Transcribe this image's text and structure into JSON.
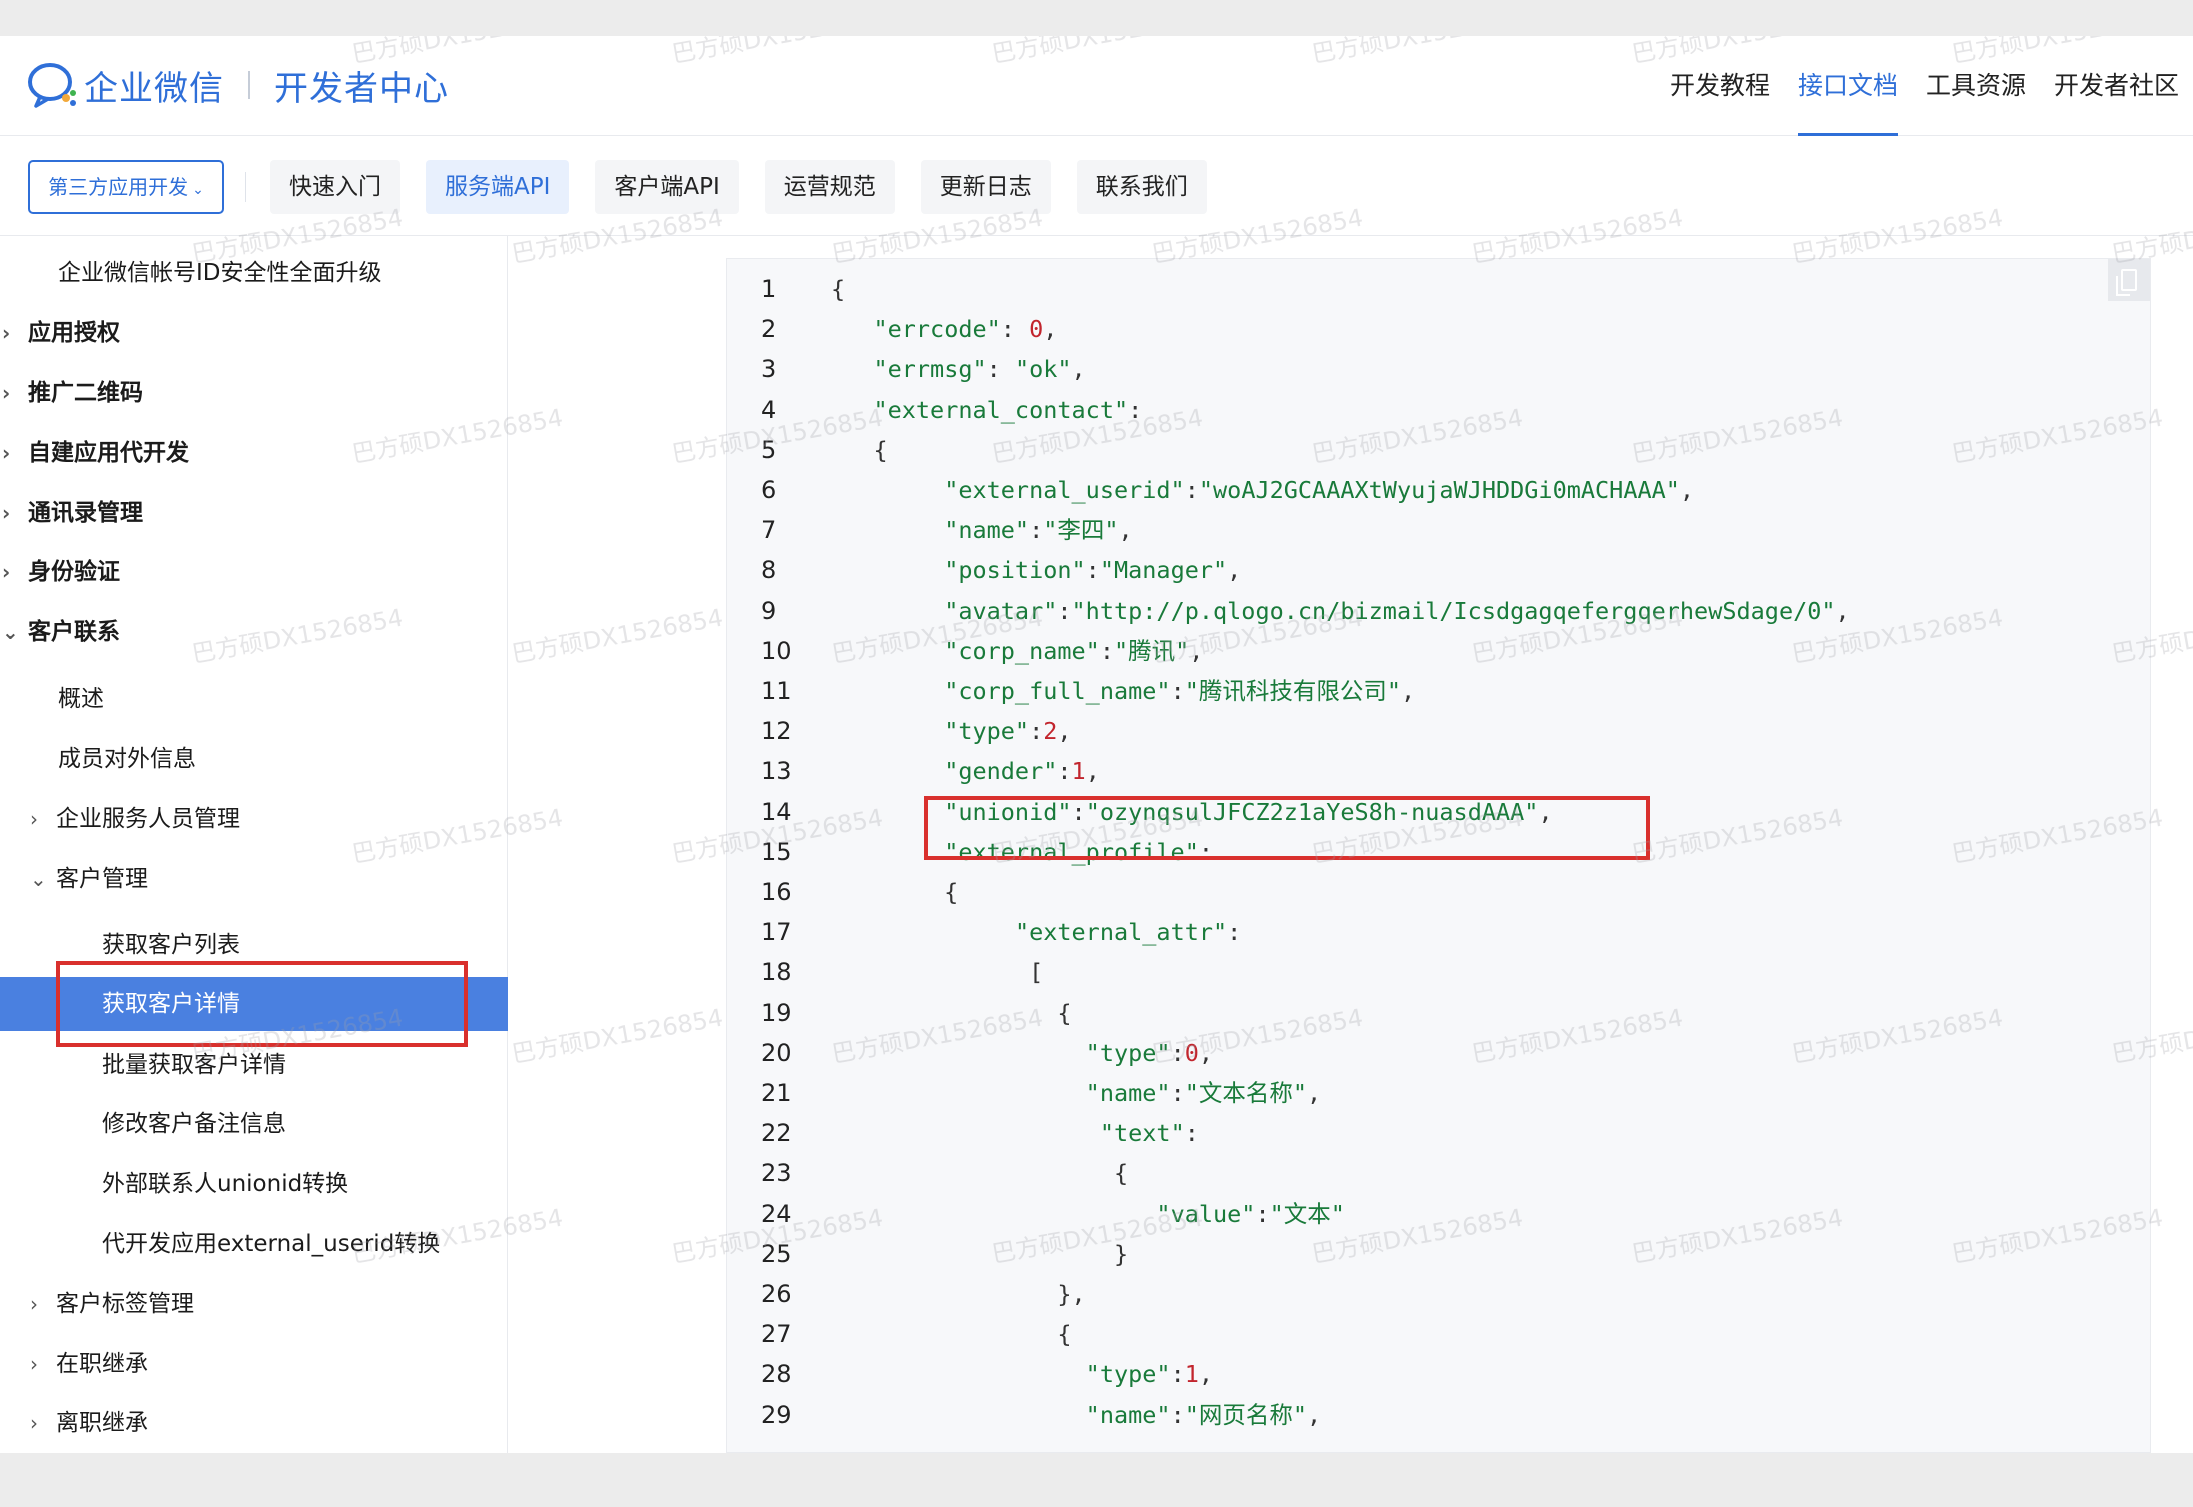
{
  "header": {
    "logo_text": "企业微信",
    "logo_sub": "开发者中心",
    "nav": [
      {
        "label": "开发教程",
        "active": false
      },
      {
        "label": "接口文档",
        "active": true
      },
      {
        "label": "工具资源",
        "active": false
      },
      {
        "label": "开发者社区",
        "active": false
      }
    ]
  },
  "subnav": {
    "dropdown_label": "第三方应用开发",
    "tabs": [
      {
        "label": "快速入门",
        "active": false
      },
      {
        "label": "服务端API",
        "active": true
      },
      {
        "label": "客户端API",
        "active": false
      },
      {
        "label": "运营规范",
        "active": false
      },
      {
        "label": "更新日志",
        "active": false
      },
      {
        "label": "联系我们",
        "active": false
      }
    ]
  },
  "sidebar": {
    "items": [
      {
        "label": "企业微信帐号ID安全性全面升级",
        "arrow": "",
        "bold": false
      },
      {
        "label": "应用授权",
        "arrow": ">",
        "bold": true
      },
      {
        "label": "推广二维码",
        "arrow": ">",
        "bold": true
      },
      {
        "label": "自建应用代开发",
        "arrow": ">",
        "bold": true
      },
      {
        "label": "通讯录管理",
        "arrow": ">",
        "bold": true
      },
      {
        "label": "身份验证",
        "arrow": ">",
        "bold": true
      },
      {
        "label": "客户联系",
        "arrow": "v",
        "bold": true
      },
      {
        "label": "概述",
        "arrow": "",
        "bold": false
      },
      {
        "label": "成员对外信息",
        "arrow": "",
        "bold": false
      },
      {
        "label": "企业服务人员管理",
        "arrow": ">",
        "bold": false
      },
      {
        "label": "客户管理",
        "arrow": "v",
        "bold": false
      },
      {
        "label": "获取客户列表",
        "arrow": "",
        "bold": false
      },
      {
        "label": "获取客户详情",
        "arrow": "",
        "bold": false,
        "selected": true
      },
      {
        "label": "批量获取客户详情",
        "arrow": "",
        "bold": false
      },
      {
        "label": "修改客户备注信息",
        "arrow": "",
        "bold": false
      },
      {
        "label": "外部联系人unionid转换",
        "arrow": "",
        "bold": false
      },
      {
        "label": "代开发应用external_userid转换",
        "arrow": "",
        "bold": false
      },
      {
        "label": "客户标签管理",
        "arrow": ">",
        "bold": false
      },
      {
        "label": "在职继承",
        "arrow": ">",
        "bold": false
      },
      {
        "label": "离职继承",
        "arrow": ">",
        "bold": false
      }
    ]
  },
  "code": {
    "lines": [
      {
        "n": "1",
        "t": "{"
      },
      {
        "n": "2",
        "t": "   \"errcode\": 0,"
      },
      {
        "n": "3",
        "t": "   \"errmsg\": \"ok\","
      },
      {
        "n": "4",
        "t": "   \"external_contact\":"
      },
      {
        "n": "5",
        "t": "   {"
      },
      {
        "n": "6",
        "t": "        \"external_userid\":\"woAJ2GCAAAXtWyujaWJHDDGi0mACHAAA\","
      },
      {
        "n": "7",
        "t": "        \"name\":\"李四\","
      },
      {
        "n": "8",
        "t": "        \"position\":\"Manager\","
      },
      {
        "n": "9",
        "t": "        \"avatar\":\"http://p.qlogo.cn/bizmail/IcsdgagqefergqerhewSdage/0\","
      },
      {
        "n": "10",
        "t": "        \"corp_name\":\"腾讯\","
      },
      {
        "n": "11",
        "t": "        \"corp_full_name\":\"腾讯科技有限公司\","
      },
      {
        "n": "12",
        "t": "        \"type\":2,"
      },
      {
        "n": "13",
        "t": "        \"gender\":1,"
      },
      {
        "n": "14",
        "t": "        \"unionid\":\"ozynqsulJFCZ2z1aYeS8h-nuasdAAA\","
      },
      {
        "n": "15",
        "t": "        \"external_profile\":"
      },
      {
        "n": "16",
        "t": "        {"
      },
      {
        "n": "17",
        "t": "             \"external_attr\":"
      },
      {
        "n": "18",
        "t": "              ["
      },
      {
        "n": "19",
        "t": "                {"
      },
      {
        "n": "20",
        "t": "                  \"type\":0,"
      },
      {
        "n": "21",
        "t": "                  \"name\":\"文本名称\","
      },
      {
        "n": "22",
        "t": "                   \"text\":"
      },
      {
        "n": "23",
        "t": "                    {"
      },
      {
        "n": "24",
        "t": "                       \"value\":\"文本\""
      },
      {
        "n": "25",
        "t": "                    }"
      },
      {
        "n": "26",
        "t": "                },"
      },
      {
        "n": "27",
        "t": "                {"
      },
      {
        "n": "28",
        "t": "                  \"type\":1,"
      },
      {
        "n": "29",
        "t": "                  \"name\":\"网页名称\","
      }
    ]
  },
  "watermark": "巴方硕DX1526854",
  "colors": {
    "brand": "#2f6fd8",
    "selected_bg": "#4a80e0",
    "highlight_box": "#d9302d",
    "json_key": "#197a3a",
    "json_number": "#c2252d"
  }
}
